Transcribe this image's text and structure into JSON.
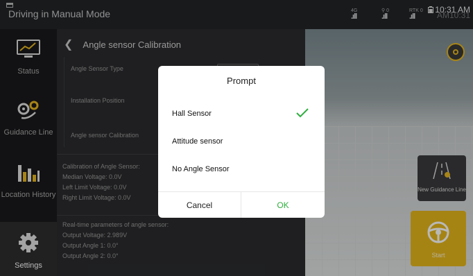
{
  "statusbar": {
    "mode": "Driving in Manual Mode",
    "sig1": {
      "top": "4G",
      "bars": ".ıll"
    },
    "sig2": {
      "top": "⚲ 0",
      "bars": ".ıll"
    },
    "sig3": {
      "top": "RTK 0",
      "bars": ".ıll"
    },
    "clock": "10:31 AM",
    "clock_shadow": "AM10:31"
  },
  "nav": {
    "items": [
      {
        "label": "Status"
      },
      {
        "label": "Guidance Line"
      },
      {
        "label": "Location History"
      },
      {
        "label": "Settings"
      }
    ]
  },
  "panel": {
    "title": "Angle sensor Calibration",
    "rows": [
      {
        "label": "Angle Sensor Type"
      },
      {
        "label": "Installation Position"
      },
      {
        "label": "Angle sensor Calibration"
      }
    ],
    "calibration": {
      "header": "Calibration of Angle Sensor:",
      "median": "Median Voltage: 0.0V",
      "left": "Left Limit Voltage: 0.0V",
      "right": "Right Limit Voltage: 0.0V"
    },
    "realtime": {
      "header": "Real-time parameters of angle sensor:",
      "voltage": "Output Voltage: 2.989V",
      "angle1": "Output Angle 1: 0.0°",
      "angle2": "Output Angle 2: 0.0°"
    }
  },
  "map": {
    "new_guidance_label": "New Guidance Line",
    "start_label": "Start"
  },
  "modal": {
    "title": "Prompt",
    "options": [
      {
        "label": "Hall Sensor",
        "selected": true
      },
      {
        "label": "Attitude sensor",
        "selected": false
      },
      {
        "label": "No Angle Sensor",
        "selected": false
      }
    ],
    "cancel_label": "Cancel",
    "ok_label": "OK"
  },
  "colors": {
    "accent": "#e6b81c",
    "ok_green": "#2fae3f"
  }
}
